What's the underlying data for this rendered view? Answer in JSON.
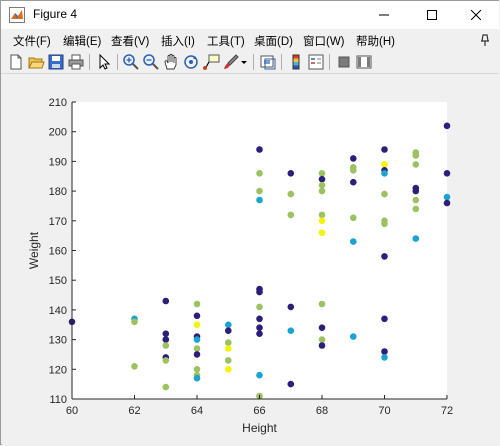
{
  "window": {
    "title": "Figure 4"
  },
  "menu": {
    "items": [
      "文件(F)",
      "编辑(E)",
      "查看(V)",
      "插入(I)",
      "工具(T)",
      "桌面(D)",
      "窗口(W)",
      "帮助(H)"
    ]
  },
  "toolbar": {
    "buttons": [
      "new-figure-icon",
      "open-file-icon",
      "save-icon",
      "print-icon",
      "edit-plot-arrow-icon",
      "zoom-in-icon",
      "zoom-out-icon",
      "pan-hand-icon",
      "rotate-3d-icon",
      "data-cursor-icon",
      "brush-icon",
      "link-plot-icon",
      "colorbar-icon",
      "legend-icon",
      "hide-plot-tools-icon",
      "show-plot-tools-icon"
    ]
  },
  "colors": {
    "dark": "#2c1f79",
    "cyan": "#1ba3d2",
    "olive": "#9bc160",
    "yellow": "#f5f500"
  },
  "chart_data": {
    "type": "scatter",
    "title": "",
    "xlabel": "Height",
    "ylabel": "Weight",
    "xlim": [
      60,
      72
    ],
    "ylim": [
      110,
      210
    ],
    "xticks": [
      "60",
      "62",
      "64",
      "66",
      "68",
      "70",
      "72"
    ],
    "yticks": [
      "110",
      "120",
      "130",
      "140",
      "150",
      "160",
      "170",
      "180",
      "190",
      "200",
      "210"
    ],
    "grid": false,
    "legend": "none",
    "points": [
      {
        "x": 60,
        "y": 136,
        "c": "dark"
      },
      {
        "x": 62,
        "y": 137,
        "c": "cyan"
      },
      {
        "x": 62,
        "y": 136,
        "c": "olive"
      },
      {
        "x": 62,
        "y": 121,
        "c": "olive"
      },
      {
        "x": 63,
        "y": 143,
        "c": "dark"
      },
      {
        "x": 63,
        "y": 132,
        "c": "dark"
      },
      {
        "x": 63,
        "y": 130,
        "c": "dark"
      },
      {
        "x": 63,
        "y": 128,
        "c": "olive"
      },
      {
        "x": 63,
        "y": 124,
        "c": "dark"
      },
      {
        "x": 63,
        "y": 123,
        "c": "olive"
      },
      {
        "x": 63,
        "y": 114,
        "c": "olive"
      },
      {
        "x": 64,
        "y": 142,
        "c": "olive"
      },
      {
        "x": 64,
        "y": 138,
        "c": "dark"
      },
      {
        "x": 64,
        "y": 135,
        "c": "yellow"
      },
      {
        "x": 64,
        "y": 131,
        "c": "dark"
      },
      {
        "x": 64,
        "y": 130,
        "c": "cyan"
      },
      {
        "x": 64,
        "y": 127,
        "c": "olive"
      },
      {
        "x": 64,
        "y": 125,
        "c": "dark"
      },
      {
        "x": 64,
        "y": 120,
        "c": "olive"
      },
      {
        "x": 64,
        "y": 118,
        "c": "olive"
      },
      {
        "x": 64,
        "y": 117,
        "c": "cyan"
      },
      {
        "x": 65,
        "y": 135,
        "c": "cyan"
      },
      {
        "x": 65,
        "y": 133,
        "c": "dark"
      },
      {
        "x": 65,
        "y": 129,
        "c": "olive"
      },
      {
        "x": 65,
        "y": 127,
        "c": "yellow"
      },
      {
        "x": 65,
        "y": 123,
        "c": "olive"
      },
      {
        "x": 65,
        "y": 120,
        "c": "yellow"
      },
      {
        "x": 66,
        "y": 194,
        "c": "dark"
      },
      {
        "x": 66,
        "y": 186,
        "c": "olive"
      },
      {
        "x": 66,
        "y": 180,
        "c": "olive"
      },
      {
        "x": 66,
        "y": 177,
        "c": "cyan"
      },
      {
        "x": 66,
        "y": 147,
        "c": "dark"
      },
      {
        "x": 66,
        "y": 146,
        "c": "dark"
      },
      {
        "x": 66,
        "y": 141,
        "c": "olive"
      },
      {
        "x": 66,
        "y": 137,
        "c": "dark"
      },
      {
        "x": 66,
        "y": 134,
        "c": "dark"
      },
      {
        "x": 66,
        "y": 132,
        "c": "dark"
      },
      {
        "x": 66,
        "y": 118,
        "c": "cyan"
      },
      {
        "x": 66,
        "y": 111,
        "c": "olive"
      },
      {
        "x": 67,
        "y": 186,
        "c": "dark"
      },
      {
        "x": 67,
        "y": 179,
        "c": "olive"
      },
      {
        "x": 67,
        "y": 172,
        "c": "olive"
      },
      {
        "x": 67,
        "y": 141,
        "c": "dark"
      },
      {
        "x": 67,
        "y": 133,
        "c": "cyan"
      },
      {
        "x": 67,
        "y": 115,
        "c": "dark"
      },
      {
        "x": 68,
        "y": 186,
        "c": "olive"
      },
      {
        "x": 68,
        "y": 184,
        "c": "dark"
      },
      {
        "x": 68,
        "y": 182,
        "c": "olive"
      },
      {
        "x": 68,
        "y": 180,
        "c": "olive"
      },
      {
        "x": 68,
        "y": 172,
        "c": "olive"
      },
      {
        "x": 68,
        "y": 170,
        "c": "yellow"
      },
      {
        "x": 68,
        "y": 166,
        "c": "yellow"
      },
      {
        "x": 68,
        "y": 142,
        "c": "olive"
      },
      {
        "x": 68,
        "y": 134,
        "c": "dark"
      },
      {
        "x": 68,
        "y": 130,
        "c": "olive"
      },
      {
        "x": 68,
        "y": 128,
        "c": "dark"
      },
      {
        "x": 69,
        "y": 191,
        "c": "dark"
      },
      {
        "x": 69,
        "y": 188,
        "c": "olive"
      },
      {
        "x": 69,
        "y": 187,
        "c": "olive"
      },
      {
        "x": 69,
        "y": 183,
        "c": "dark"
      },
      {
        "x": 69,
        "y": 171,
        "c": "olive"
      },
      {
        "x": 69,
        "y": 163,
        "c": "cyan"
      },
      {
        "x": 69,
        "y": 131,
        "c": "cyan"
      },
      {
        "x": 70,
        "y": 194,
        "c": "dark"
      },
      {
        "x": 70,
        "y": 189,
        "c": "yellow"
      },
      {
        "x": 70,
        "y": 187,
        "c": "dark"
      },
      {
        "x": 70,
        "y": 186,
        "c": "cyan"
      },
      {
        "x": 70,
        "y": 179,
        "c": "olive"
      },
      {
        "x": 70,
        "y": 170,
        "c": "olive"
      },
      {
        "x": 70,
        "y": 169,
        "c": "olive"
      },
      {
        "x": 70,
        "y": 158,
        "c": "dark"
      },
      {
        "x": 70,
        "y": 137,
        "c": "dark"
      },
      {
        "x": 70,
        "y": 126,
        "c": "dark"
      },
      {
        "x": 70,
        "y": 124,
        "c": "cyan"
      },
      {
        "x": 71,
        "y": 193,
        "c": "olive"
      },
      {
        "x": 71,
        "y": 192,
        "c": "olive"
      },
      {
        "x": 71,
        "y": 189,
        "c": "olive"
      },
      {
        "x": 71,
        "y": 181,
        "c": "dark"
      },
      {
        "x": 71,
        "y": 180,
        "c": "dark"
      },
      {
        "x": 71,
        "y": 177,
        "c": "olive"
      },
      {
        "x": 71,
        "y": 174,
        "c": "olive"
      },
      {
        "x": 71,
        "y": 164,
        "c": "cyan"
      },
      {
        "x": 72,
        "y": 202,
        "c": "dark"
      },
      {
        "x": 72,
        "y": 186,
        "c": "dark"
      },
      {
        "x": 72,
        "y": 178,
        "c": "cyan"
      },
      {
        "x": 72,
        "y": 176,
        "c": "dark"
      }
    ]
  }
}
